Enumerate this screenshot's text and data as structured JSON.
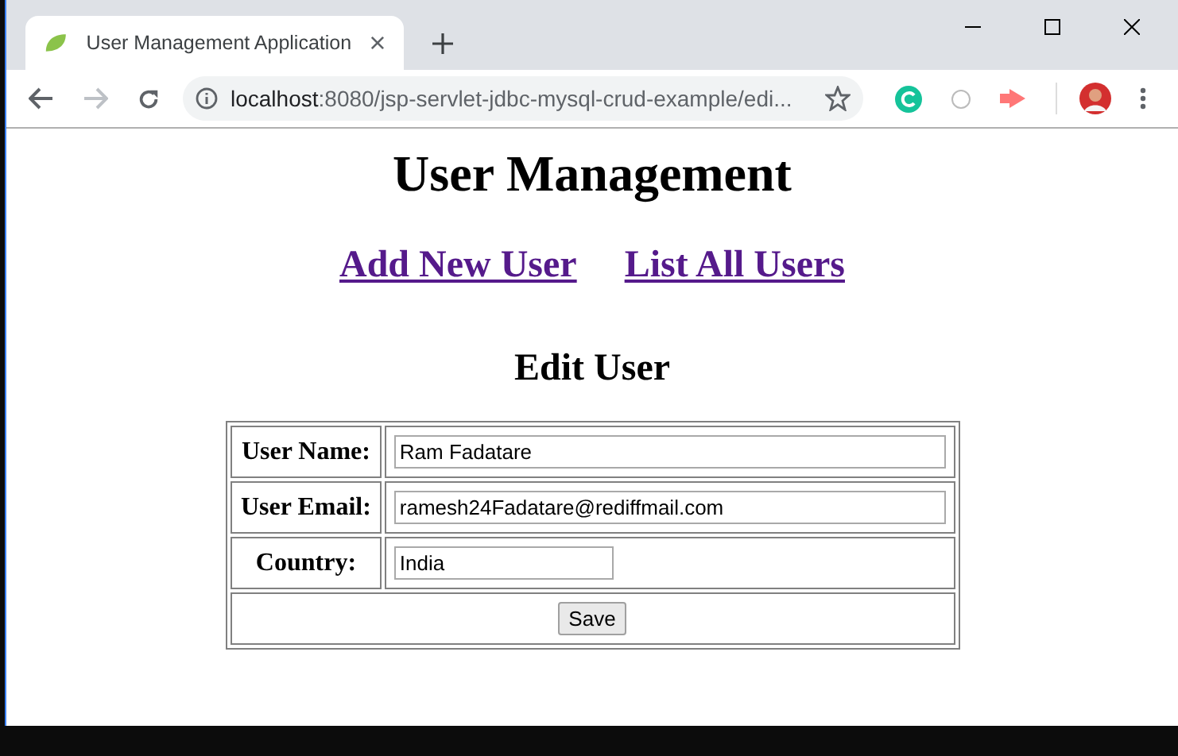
{
  "tab": {
    "title": "User Management Application",
    "selected": true
  },
  "address_bar": {
    "host": "localhost",
    "path": ":8080/jsp-servlet-jdbc-mysql-crud-example/edi..."
  },
  "page": {
    "heading": "User Management",
    "links": [
      "Add New User",
      "List All Users"
    ],
    "form_title": "Edit User",
    "fields": [
      {
        "label": "User Name:",
        "value": "Ram Fadatare",
        "kind": "wide"
      },
      {
        "label": "User Email:",
        "value": "ramesh24Fadatare@rediffmail.com",
        "kind": "wide"
      },
      {
        "label": "Country:",
        "value": "India",
        "kind": "short"
      }
    ],
    "submit": "Save"
  }
}
